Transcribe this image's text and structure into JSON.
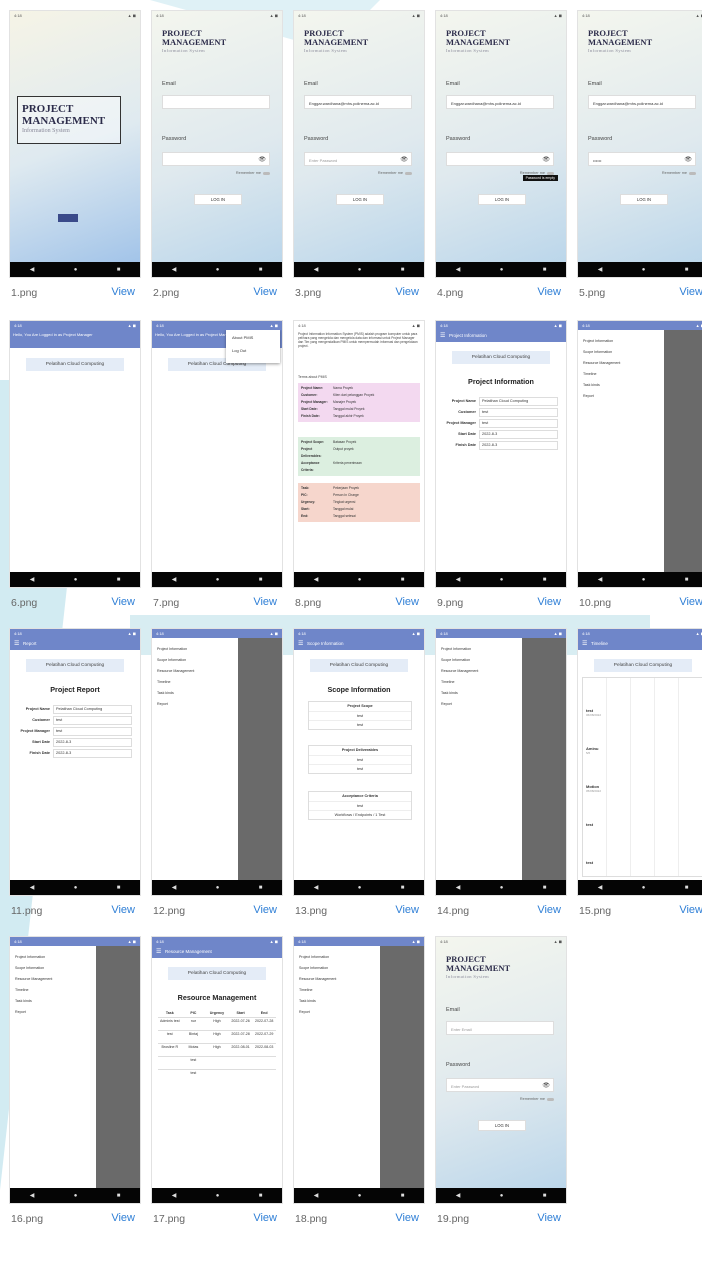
{
  "status": {
    "time": "4:18",
    "icons": "▲ ◼"
  },
  "nav": {
    "back": "◀",
    "home": "●",
    "recent": "■"
  },
  "view_label": "View",
  "captions": [
    "1.png",
    "2.png",
    "3.png",
    "4.png",
    "5.png",
    "6.png",
    "7.png",
    "8.png",
    "9.png",
    "10.png",
    "11.png",
    "12.png",
    "13.png",
    "14.png",
    "15.png",
    "16.png",
    "17.png",
    "18.png",
    "19.png"
  ],
  "login": {
    "logo_line1": "PROJECT",
    "logo_line2": "MANAGEMENT",
    "logo_sub": "Information System",
    "email_label": "Email",
    "password_label": "Password",
    "email_placeholder": "Enter Email",
    "password_placeholder": "Enter Password",
    "email_value": "Enggar.wardhana@mhs.polinema.ac.id",
    "password_mask": "••••••",
    "remember": "Remember me",
    "login_button": "LOG IN",
    "tooltip": "Password is empty",
    "eye": "👁"
  },
  "splash": {
    "line1": "PROJECT",
    "line2": "MANAGEMENT",
    "sub": "Information System"
  },
  "home": {
    "greeting": "Hello, You Are Logged in as Project Manager",
    "course": "Pelatihan Cloud Computing",
    "menu_about": "About PMIS",
    "menu_logout": "Log Out"
  },
  "about": {
    "intro": "Project Information Information System (PMIS) adalah program komputer untuk para pelihara yang mengelola dan mengelola data dan informasi untuk Project Manager dan Tim yang mengendalikan PMIS untuk mempermudah informasi dan pengelolaan project.",
    "fields_title": "Terms about PMIS",
    "block1": [
      [
        "Project Name:",
        "Nama Proyek"
      ],
      [
        "Customer:",
        "Klien dari pelanggan Proyek"
      ],
      [
        "Project Manager:",
        "Manajer Proyek"
      ],
      [
        "Start Date:",
        "Tanggal mulai Proyek"
      ],
      [
        "Finish Date:",
        "Tanggal akhir Proyek"
      ]
    ],
    "block2": [
      [
        "Project Scope:",
        "Batasan Proyek"
      ],
      [
        "Project Deliverables:",
        "Output proyek"
      ],
      [
        "Acceptance Criteria:",
        "Kriteria penerimaan"
      ]
    ],
    "block3": [
      [
        "Task:",
        "Pekerjaan Proyek"
      ],
      [
        "PIC:",
        "Person In Charge"
      ],
      [
        "Urgency:",
        "Tingkat urgensi"
      ],
      [
        "Start:",
        "Tanggal mulai"
      ],
      [
        "End:",
        "Tanggal selesai"
      ]
    ]
  },
  "appbars": {
    "project": "Project Information",
    "report": "Report",
    "scope": "Scope Information",
    "timeline": "Timeline",
    "resource": "Resource Management"
  },
  "project_info": {
    "title": "Project Information",
    "report_title": "Project Report",
    "rows": [
      [
        "Project Name",
        "Pelatihan Cloud Computing"
      ],
      [
        "Customer",
        "test"
      ],
      [
        "Project Manager",
        "test"
      ],
      [
        "Start Date",
        "2022-8-3"
      ],
      [
        "Finish Date",
        "2022-8-3"
      ]
    ]
  },
  "drawer_items": [
    "Project Information",
    "Scope Information",
    "Resource Management",
    "Timeline",
    "Task kinds",
    "Report"
  ],
  "scope": {
    "title": "Scope Information",
    "h1": "Project Scope",
    "h2": "Project Deliverables",
    "h3": "Acceptance Criteria",
    "v": "test",
    "v2": "Workflows / Endpoints / 1 Test"
  },
  "timeline": {
    "rows": [
      "test",
      "Aminu",
      "Motion",
      "test",
      "test"
    ],
    "subs": [
      "06/08/2022",
      "5/6",
      "05/08/2022",
      "",
      ""
    ]
  },
  "resource": {
    "title": "Resource Management",
    "headers": [
      "Task",
      "PIC",
      "Urgency",
      "Start",
      "End"
    ],
    "rows": [
      [
        "Adminis test",
        "nur",
        "High",
        "2022-07-26",
        "2022-07-28"
      ],
      [
        "test",
        "Bintaj",
        "High",
        "2022-07-28",
        "2022-07-29"
      ],
      [
        "Brosline R",
        "Motas",
        "High",
        "2022-08-01",
        "2022-08-03"
      ],
      [
        "",
        "test",
        "",
        "",
        ""
      ],
      [
        "",
        "test",
        "",
        "",
        ""
      ]
    ]
  }
}
